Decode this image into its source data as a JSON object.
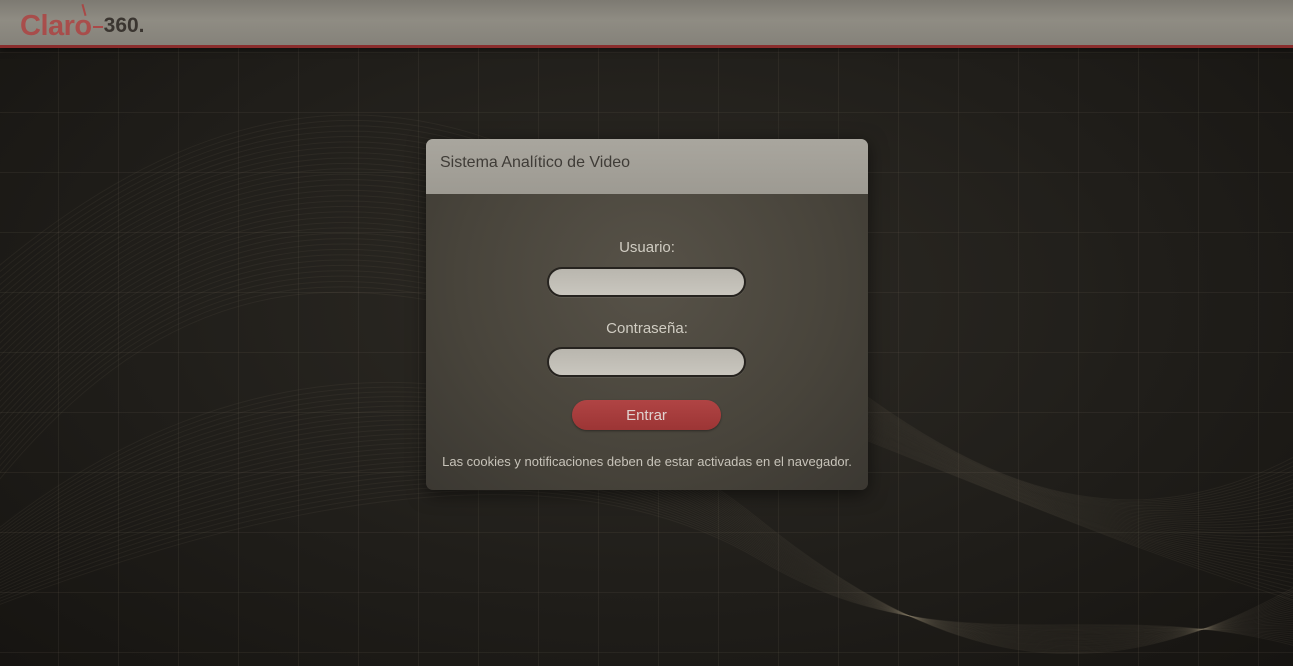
{
  "header": {
    "logo_brand": "Claro",
    "logo_suffix": "360."
  },
  "login": {
    "title": "Sistema Analítico de Video",
    "username_label": "Usuario:",
    "username_value": "",
    "password_label": "Contraseña:",
    "password_value": "",
    "submit_label": "Entrar",
    "notice": "Las cookies y notificaciones deben de estar activadas en el navegador."
  },
  "colors": {
    "brand_red": "#b23a3a",
    "button_red": "#a63c3c",
    "header_bg": "#8a877f",
    "dialog_bg": "#4c483f"
  }
}
